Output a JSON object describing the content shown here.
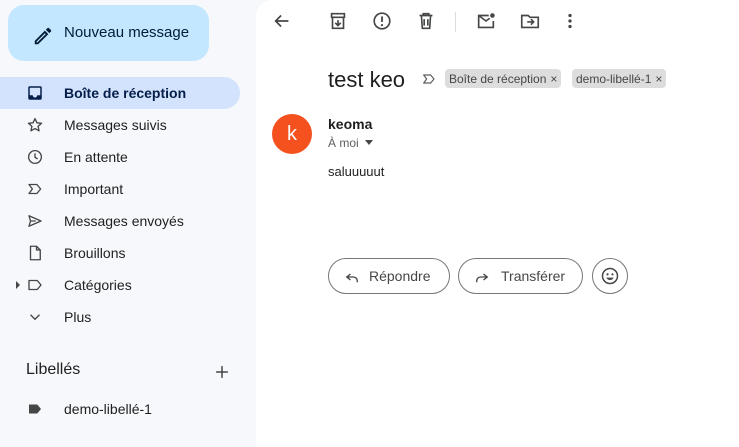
{
  "sidebar": {
    "compose_label": "Nouveau message",
    "items": [
      {
        "label": "Boîte de réception",
        "icon": "inbox-icon",
        "active": true
      },
      {
        "label": "Messages suivis",
        "icon": "star-icon"
      },
      {
        "label": "En attente",
        "icon": "clock-icon"
      },
      {
        "label": "Important",
        "icon": "important-icon"
      },
      {
        "label": "Messages envoyés",
        "icon": "send-icon"
      },
      {
        "label": "Brouillons",
        "icon": "draft-icon"
      },
      {
        "label": "Catégories",
        "icon": "label-outline-icon"
      },
      {
        "label": "Plus",
        "icon": "chevron-down-icon"
      }
    ],
    "labels_title": "Libellés",
    "labels": [
      {
        "label": "demo-libellé-1",
        "icon": "label-filled-icon"
      }
    ]
  },
  "toolbar": {
    "icons": [
      "back-arrow-icon",
      "archive-icon",
      "report-spam-icon",
      "delete-icon",
      "mark-unread-icon",
      "move-to-icon",
      "more-vert-icon"
    ]
  },
  "message": {
    "subject": "test keo",
    "chips": [
      "Boîte de réception",
      "demo-libellé-1"
    ],
    "chip_close": "×",
    "sender_initial": "k",
    "sender_name": "keoma",
    "recipient": "À moi",
    "body": "saluuuuut",
    "reply_label": "Répondre",
    "forward_label": "Transférer"
  },
  "colors": {
    "avatar": "#f4511e",
    "compose_bg": "#c2e7ff",
    "active_nav_bg": "#d3e3fd"
  }
}
